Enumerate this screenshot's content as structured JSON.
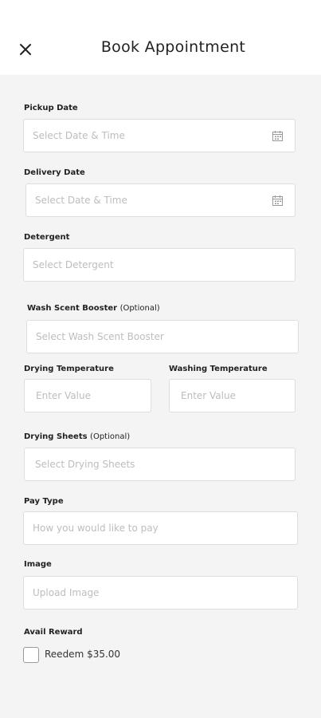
{
  "header": {
    "title": "Book Appointment"
  },
  "form": {
    "pickup_date": {
      "label": "Pickup Date",
      "placeholder": "Select Date & Time"
    },
    "delivery_date": {
      "label": "Delivery Date",
      "placeholder": "Select Date & Time"
    },
    "detergent": {
      "label": "Detergent",
      "placeholder": "Select Detergent"
    },
    "wash_scent_booster": {
      "label": "Wash Scent Booster",
      "label_suffix": "(Optional)",
      "placeholder": "Select Wash Scent Booster"
    },
    "drying_temperature": {
      "label": "Drying Temperature",
      "placeholder": "Enter Value"
    },
    "washing_temperature": {
      "label": "Washing Temperature",
      "placeholder": "Enter Value"
    },
    "drying_sheets": {
      "label": "Drying Sheets",
      "label_suffix": "(Optional)",
      "placeholder": "Select Drying Sheets"
    },
    "pay_type": {
      "label": "Pay Type",
      "placeholder": "How you would like to pay"
    },
    "image": {
      "label": "Image",
      "placeholder": "Upload Image"
    },
    "avail_reward": {
      "label": "Avail Reward",
      "checkbox_text": "Reedem $35.00",
      "checked": false
    }
  },
  "icons": {
    "close": "close-icon",
    "calendar": "calendar-icon"
  }
}
